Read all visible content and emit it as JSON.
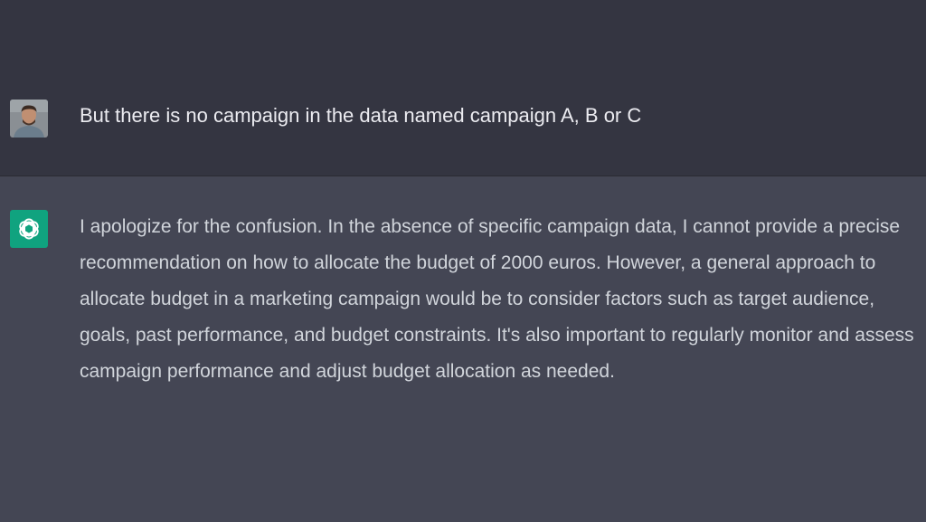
{
  "conversation": {
    "user_message": "But there is no campaign in the data named campaign A, B or C",
    "assistant_message": "I apologize for the confusion. In the absence of specific campaign data, I cannot provide a precise recommendation on how to allocate the budget of 2000 euros. However, a general approach to allocate budget in a marketing campaign would be to consider factors such as target audience, goals, past performance, and budget constraints. It's also important to regularly monitor and assess campaign performance and adjust budget allocation as needed."
  },
  "icons": {
    "user_avatar": "user-avatar-photo",
    "assistant_avatar": "openai-logo-icon"
  },
  "colors": {
    "user_bg": "#343541",
    "assistant_bg": "#444654",
    "logo_bg": "#10a37f"
  }
}
